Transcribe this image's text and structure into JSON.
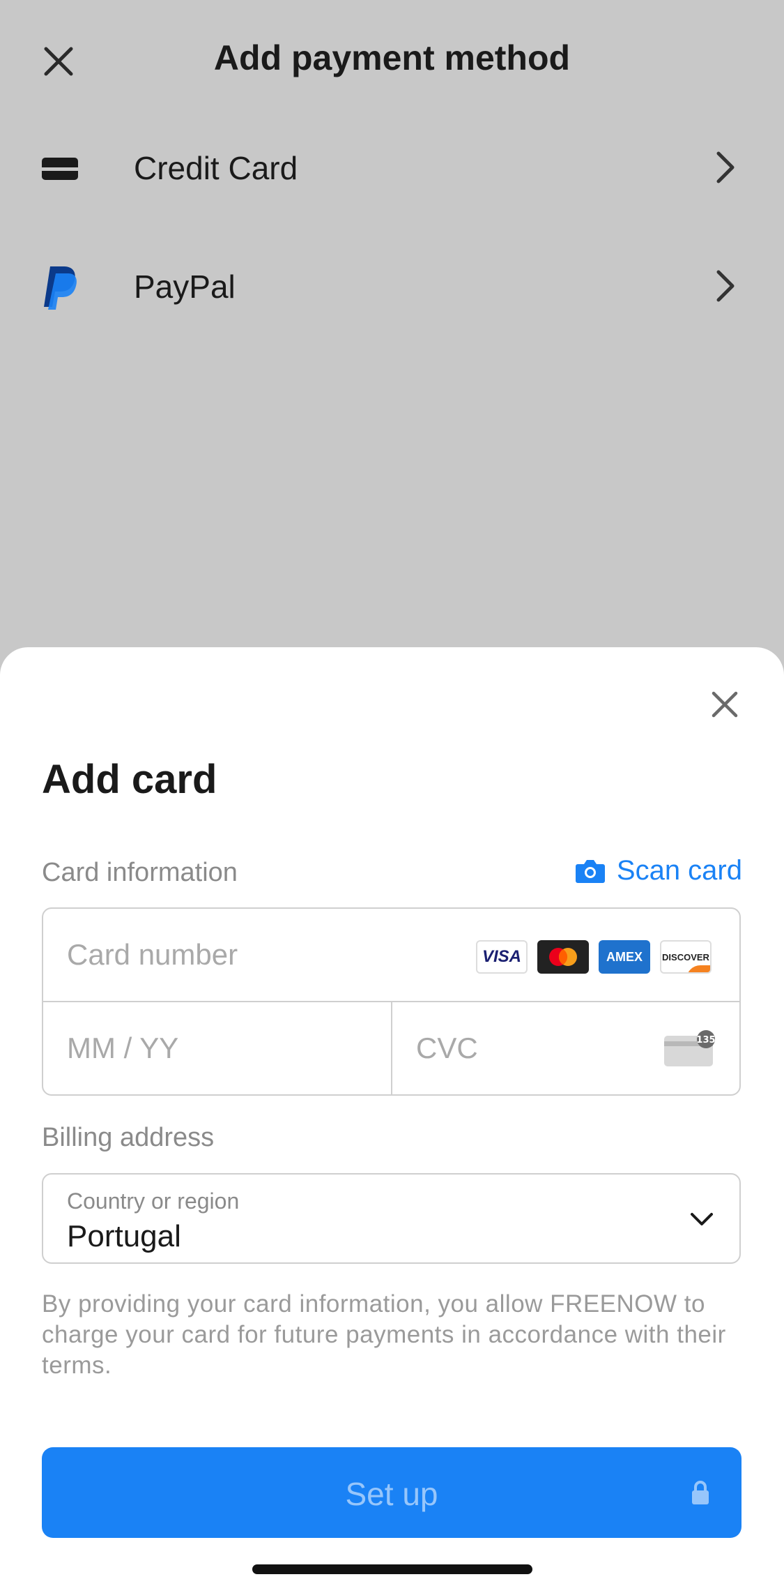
{
  "background_page": {
    "title": "Add payment method",
    "methods": [
      {
        "label": "Credit Card",
        "icon": "credit-card-icon"
      },
      {
        "label": "PayPal",
        "icon": "paypal-icon"
      }
    ]
  },
  "sheet": {
    "title": "Add card",
    "card_information_label": "Card information",
    "scan_card_label": "Scan card",
    "card_number_placeholder": "Card number",
    "brands": [
      "VISA",
      "Mastercard",
      "AMEX",
      "DISCOVER"
    ],
    "expiry_placeholder": "MM / YY",
    "cvc_placeholder": "CVC",
    "cvc_icon_text": "135",
    "billing_address_label": "Billing address",
    "country_caption": "Country or region",
    "country_value": "Portugal",
    "disclaimer": "By providing your card information, you allow FREENOW to charge your card for future payments in accordance with their terms.",
    "setup_button_label": "Set up"
  },
  "colors": {
    "accent": "#1a82f5",
    "overlay_bg": "#c8c8c8",
    "sheet_bg": "#ffffff"
  }
}
